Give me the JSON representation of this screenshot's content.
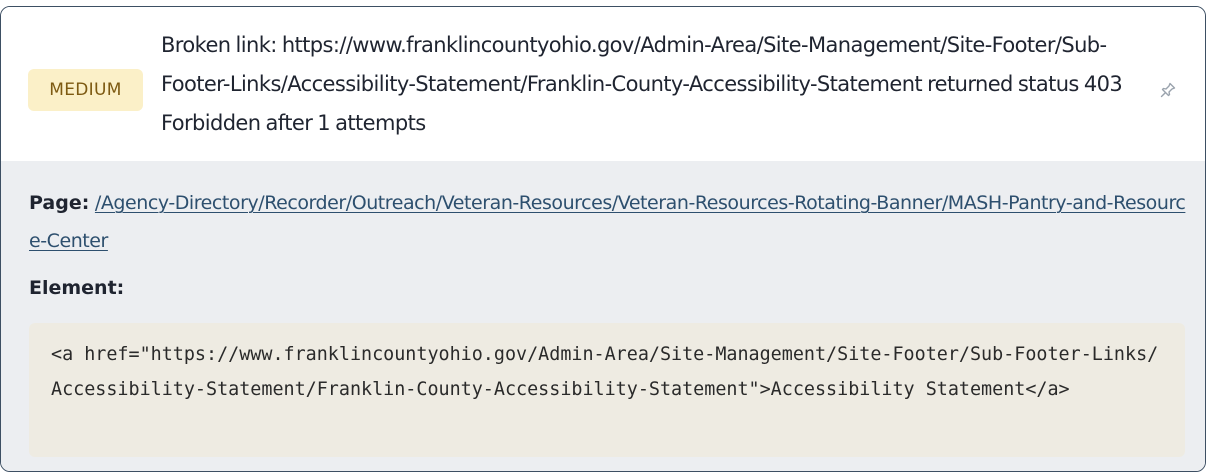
{
  "issue": {
    "severity": "MEDIUM",
    "colors": {
      "badge_bg": "#fbf0c8",
      "badge_text": "#7d5a12",
      "card_border": "#3d4f63",
      "details_bg": "#eceef1",
      "link": "#2d4f6e",
      "code_bg": "#eeebe2"
    },
    "message": "Broken link: https://www.franklincountyohio.gov/Admin-Area/Site-Management/Site-Footer/Sub-Footer-Links/Accessibility-Statement/Franklin-County-Accessibility-Statement returned status 403 Forbidden after 1 attempts",
    "toggle_icon": "pin-icon"
  },
  "details": {
    "page_label": "Page:",
    "page_url": "/Agency-Directory/Recorder/Outreach/Veteran-Resources/Veteran-Resources-Rotating-Banner/MASH-Pantry-and-Resource-Center",
    "element_label": "Element:",
    "element_code": "<a href=\"https://www.franklincountyohio.gov/Admin-Area/Site-Management/Site-Footer/Sub-Footer-Links/Accessibility-Statement/Franklin-County-Accessibility-Statement\">Accessibility Statement</a>"
  }
}
